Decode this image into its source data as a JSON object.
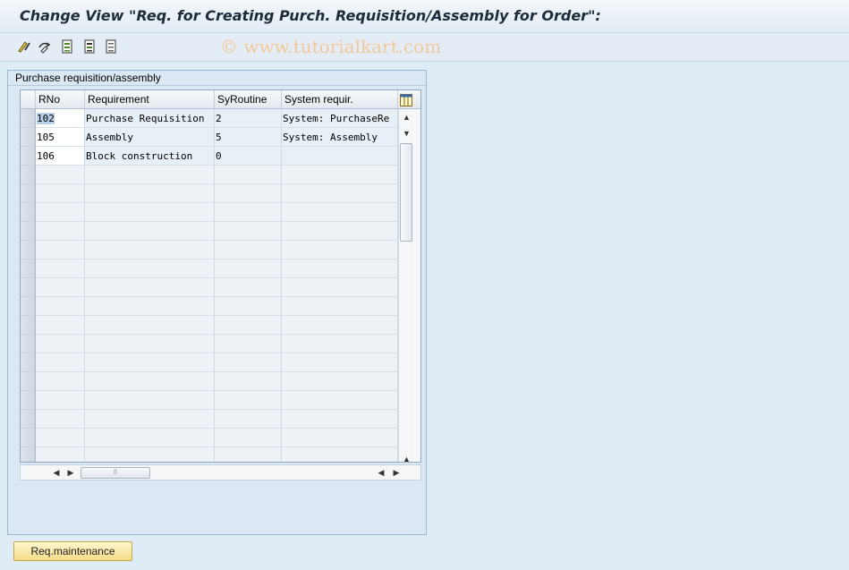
{
  "window": {
    "title": "Change View \"Req. for Creating Purch. Requisition/Assembly for Order\":"
  },
  "toolbar": {
    "buttons": [
      {
        "name": "display-change-icon"
      },
      {
        "name": "other-entry-icon"
      },
      {
        "name": "select-all-icon"
      },
      {
        "name": "select-block-icon"
      },
      {
        "name": "deselect-all-icon"
      }
    ]
  },
  "watermark": "© www.tutorialkart.com",
  "panel": {
    "title": "Purchase requisition/assembly"
  },
  "table": {
    "columns": [
      "RNo",
      "Requirement",
      "SyRoutine",
      "System requir."
    ],
    "rows": [
      [
        "102",
        "Purchase Requisition",
        "2",
        "System: PurchaseRe"
      ],
      [
        "105",
        "Assembly",
        "5",
        "System: Assembly"
      ],
      [
        "106",
        "Block construction",
        "0",
        ""
      ]
    ],
    "empty_rows": 16
  },
  "buttons": {
    "req_maintenance": "Req.maintenance"
  },
  "colors": {
    "background": "#dfebf5",
    "button_accent": "#f4dc86",
    "selection": "#b9d1ea"
  }
}
